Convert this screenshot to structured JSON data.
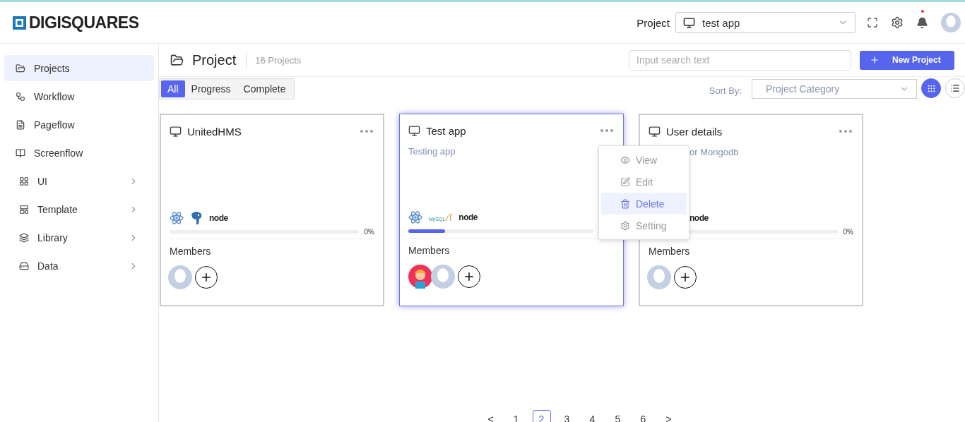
{
  "brand": {
    "name": "DIGISQUARES"
  },
  "header": {
    "project_label": "Project",
    "project_select": "test app"
  },
  "sidebar": {
    "items": [
      {
        "label": "Projects",
        "kind": "link",
        "selected": true
      },
      {
        "label": "Workflow",
        "kind": "link",
        "selected": false
      },
      {
        "label": "Pageflow",
        "kind": "link",
        "selected": false
      },
      {
        "label": "Screenflow",
        "kind": "link",
        "selected": false
      },
      {
        "label": "UI",
        "kind": "group",
        "selected": false
      },
      {
        "label": "Template",
        "kind": "group",
        "selected": false
      },
      {
        "label": "Library",
        "kind": "group",
        "selected": false
      },
      {
        "label": "Data",
        "kind": "group",
        "selected": false
      }
    ]
  },
  "page": {
    "title": "Project",
    "count": "16 Projects",
    "search": {
      "placeholder": "Input search text"
    },
    "new_button": "New Project"
  },
  "filters": [
    {
      "label": "All",
      "selected": true
    },
    {
      "label": "Progress",
      "selected": false
    },
    {
      "label": "Complete",
      "selected": false
    }
  ],
  "sort": {
    "label": "Sort By:",
    "value": "Project Category"
  },
  "views": [
    {
      "kind": "grid",
      "selected": true
    },
    {
      "kind": "list",
      "selected": false
    }
  ],
  "cards": [
    {
      "title": "UnitedHMS",
      "focused": false,
      "tech": [
        {
          "kind": "react"
        },
        {
          "kind": "postgres"
        },
        {
          "kind": "node",
          "label": "node"
        }
      ],
      "percent": "0%",
      "members_label": "Members",
      "members": [
        {
          "kind": "placeholder"
        }
      ]
    },
    {
      "title": "Test app",
      "focused": true,
      "description": "Testing app",
      "tech": [
        {
          "kind": "react"
        },
        {
          "kind": "mysql",
          "label": "MySQL"
        },
        {
          "kind": "node",
          "label": "node"
        }
      ],
      "level": 0.2,
      "members_label": "Members",
      "members": [
        {
          "kind": "cartoon"
        },
        {
          "kind": "placeholder"
        }
      ],
      "menu": [
        {
          "label": "View",
          "selected": false
        },
        {
          "label": "Edit",
          "selected": false
        },
        {
          "label": "Delete",
          "selected": true
        },
        {
          "label": "Setting",
          "selected": false
        }
      ]
    },
    {
      "title": "User details",
      "focused": false,
      "description": "or Mongodb",
      "tech": [
        {
          "kind": "node",
          "label": "node"
        }
      ],
      "percent": "0%",
      "members_label": "Members",
      "members": [
        {
          "kind": "placeholder"
        }
      ]
    }
  ],
  "pagination": {
    "prev": "<",
    "next": ">",
    "pages": [
      {
        "label": "1",
        "selected": false
      },
      {
        "label": "2",
        "selected": true
      },
      {
        "label": "3",
        "selected": false
      },
      {
        "label": "4",
        "selected": false
      },
      {
        "label": "5",
        "selected": false
      },
      {
        "label": "6",
        "selected": false
      }
    ]
  }
}
